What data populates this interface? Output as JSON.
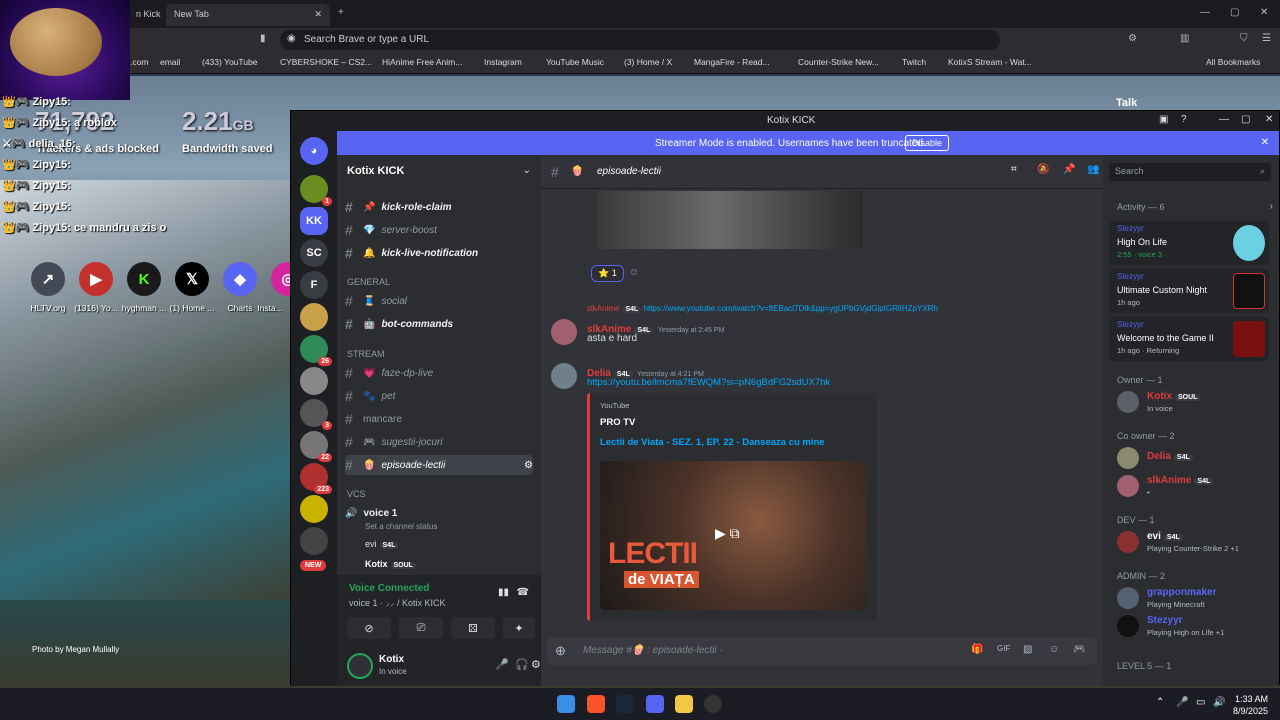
{
  "browser": {
    "tabs": [
      "n Kick",
      "New Tab"
    ],
    "url_placeholder": "Search Brave or type a URL",
    "bookmarks": [
      ".com",
      "email",
      "(433) YouTube",
      "CYBERSHOKE – CS2...",
      "HiAnime Free Anim...",
      "Instagram",
      "YouTube Music",
      "(3) Home / X",
      "MangaFire - Read...",
      "Counter-Strike New...",
      "Twitch",
      "KotixS Stream - Wat..."
    ],
    "all_bookmarks": "All Bookmarks"
  },
  "overlay": {
    "chat": [
      {
        "name": "Zipy15:",
        "text": ""
      },
      {
        "name": "Zipy15:",
        "text": "a roblox"
      },
      {
        "name": "delia_16:",
        "text": ""
      },
      {
        "name": "Zipy15:",
        "text": ""
      },
      {
        "name": "Zipy15:",
        "text": ""
      },
      {
        "name": "Zipy15:",
        "text": ""
      },
      {
        "name": "Zipy15:",
        "text": "ce mandru a zis o"
      }
    ],
    "trackers_value": "71,792",
    "trackers_label": "Trackers & ads blocked",
    "bandwidth_value": "2.21",
    "bandwidth_unit": "GB",
    "bandwidth_label": "Bandwidth saved",
    "shortcuts": [
      "HLTV.org",
      "(1316) Yo...",
      "hyghman ...",
      "(1) Home ...",
      "Charts",
      "Insta..."
    ],
    "photo_credit": "Photo by Megan Mullally",
    "talk": "Talk"
  },
  "discord": {
    "window_title": "Kotix KICK",
    "streamer_banner": "Streamer Mode is enabled. Usernames have been truncated.",
    "disable_label": "Disable",
    "server_name": "Kotix KICK",
    "guild_labels": [
      "KK",
      "SC",
      "F"
    ],
    "guild_badges": [
      "1",
      "26",
      "3",
      "22",
      "223"
    ],
    "new_label": "NEW",
    "channels": [
      {
        "name": "kick-role-claim",
        "emoji": "📌",
        "bold": true
      },
      {
        "name": "server-boost",
        "emoji": "💎",
        "bold": false
      },
      {
        "name": "kick-live-notification",
        "emoji": "🔔",
        "bold": true
      }
    ],
    "cat_general": "GENERAL",
    "general_channels": [
      {
        "name": "social",
        "emoji": "🧵",
        "bold": false
      },
      {
        "name": "bot-commands",
        "emoji": "🤖",
        "bold": true
      }
    ],
    "cat_stream": "STREAM",
    "stream_channels": [
      {
        "name": "faze-dp-live",
        "emoji": "💗"
      },
      {
        "name": "pet",
        "emoji": "🐾"
      },
      {
        "name": "mancare",
        "emoji": ""
      },
      {
        "name": "sugestii-jocuri",
        "emoji": "🎮"
      },
      {
        "name": "episoade-lectii",
        "emoji": "🍿"
      }
    ],
    "cat_vcs": "VCS",
    "voice_channel": "voice 1",
    "voice_status": "Set a channel status",
    "voice_users": [
      {
        "name": "evi",
        "tag": "S4L"
      },
      {
        "name": "Kotix",
        "tag": "SOUL"
      }
    ],
    "vc_connected": "Voice Connected",
    "vc_location": "voice 1 · ⸝⸝ / Kotix KICK",
    "user_name": "Kotix",
    "user_status": "In voice",
    "channel_header": "episoade-lectii",
    "reaction_count": "1",
    "reply_name": "slkAnime",
    "reply_tag": "S4L",
    "reply_link": "https://www.youtube.com/watch?v=ftEBacl7Dtk&pp=ygUPbGVjdGlpIGRlIHZpYXRh",
    "msg1_name": "slkAnime",
    "msg1_tag": "S4L",
    "msg1_time": "Yesterday at 2:45 PM",
    "msg1_text": "asta e hard",
    "msg2_name": "Delia",
    "msg2_tag": "S4L",
    "msg2_time": "Yesterday at 4:21 PM",
    "msg2_link": "https://youtu.be/lmcma7fEWQM?si=pN6gBdFG2sdUX7hk",
    "embed_provider": "YouTube",
    "embed_author": "PRO TV",
    "embed_title": "Lectii de Viata - SEZ. 1, EP. 22 - Danseaza cu mine",
    "thumb_text_1": "LECTII",
    "thumb_text_2": "de VIAȚA",
    "composer_placeholder": "Message #🍿 : episoade-lectii ·",
    "search_placeholder": "Search",
    "activity_header": "Activity — 6",
    "activities": [
      {
        "user": "Stezyyr",
        "game": "High On Life",
        "detail": "2:55 · voice 3 ·",
        "color": "#6ad1e3"
      },
      {
        "user": "Stezyyr",
        "game": "Ultimate Custom Night",
        "detail": "1h ago",
        "color": "#111111"
      },
      {
        "user": "Stezyyr",
        "game": "Welcome to the Game II",
        "detail": "1h ago · Returning",
        "color": "#7a1010"
      }
    ],
    "owner_header": "Owner — 1",
    "coowner_header": "Co owner — 2",
    "dev_header": "DEV — 1",
    "admin_header": "ADMIN — 2",
    "level_header": "LEVEL 5 — 1",
    "members": [
      {
        "name": "Kotix",
        "tag": "SOUL",
        "status": "In voice",
        "color": "#e03c3c"
      },
      {
        "name": "Delia",
        "tag": "S4L",
        "status": "",
        "color": "#e03c3c"
      },
      {
        "name": "slkAnime",
        "tag": "S4L",
        "status": "•",
        "color": "#e03c3c"
      },
      {
        "name": "evi",
        "tag": "S4L",
        "status": "Playing Counter-Strike 2 +1",
        "color": "#ffffff"
      },
      {
        "name": "grapponmaker",
        "tag": "",
        "status": "Playing Minecraft",
        "color": "#5865f2"
      },
      {
        "name": "Stezyyr",
        "tag": "",
        "status": "Playing High on Life +1",
        "color": "#5865f2"
      }
    ]
  },
  "taskbar": {
    "time": "1:33 AM",
    "date": "8/9/2025"
  }
}
